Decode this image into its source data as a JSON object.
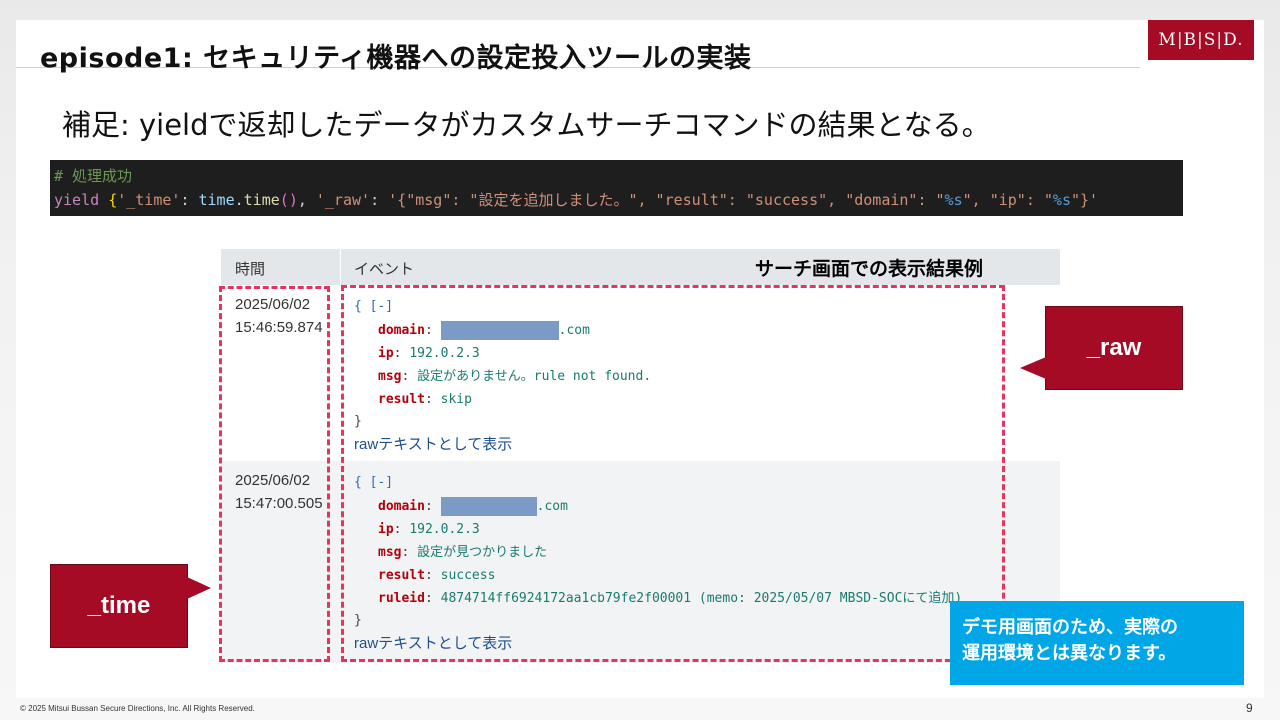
{
  "slide": {
    "title": "episode1: セキュリティ機器への設定投入ツールの実装",
    "subtitle": "補足: yieldで返却したデータがカスタムサーチコマンドの結果となる。",
    "logo": "M|B|S|D.",
    "page_number": "9",
    "copyright": "© 2025 Mitsui Bussan Secure Directions, Inc.  All Rights Reserved."
  },
  "code": {
    "comment": "# 処理成功",
    "yield_kw": "yield",
    "open_brace": "{",
    "time_key": "'_time'",
    "colon1": ": ",
    "time_obj": "time",
    "dot": ".",
    "time_fn": "time",
    "paren_open": "(",
    "paren_close": ")",
    "comma1": ", ",
    "raw_key": "'_raw'",
    "colon2": ": ",
    "raw_str_a": "'{\"msg\": \"設定を追加しました。\", \"result\": \"success\", \"domain\": \"",
    "fmt1": "%s",
    "raw_str_b": "\", \"ip\": \"",
    "fmt2": "%s",
    "raw_str_c": "\"}'"
  },
  "table": {
    "header_time": "時間",
    "header_event": "イベント",
    "header_note": "サーチ画面での表示結果例",
    "rows": [
      {
        "date": "2025/06/02",
        "time": "15:46:59.874",
        "open": "{ [-]",
        "domain_key": "domain",
        "domain_suffix": ".com",
        "ip_key": "ip",
        "ip_val": "192.0.2.3",
        "msg_key": "msg",
        "msg_val": "設定がありません。rule not found.",
        "result_key": "result",
        "result_val": "skip",
        "close": "}",
        "raw_link": "rawテキストとして表示"
      },
      {
        "date": "2025/06/02",
        "time": "15:47:00.505",
        "open": "{ [-]",
        "domain_key": "domain",
        "domain_suffix": ".com",
        "ip_key": "ip",
        "ip_val": "192.0.2.3",
        "msg_key": "msg",
        "msg_val": "設定が見つかりました",
        "result_key": "result",
        "result_val": "success",
        "ruleid_key": "ruleid",
        "ruleid_val": "4874714ff6924172aa1cb79fe2f00001 (memo: 2025/05/07 MBSD-SOCにて追加)",
        "close": "}",
        "raw_link": "rawテキストとして表示"
      }
    ]
  },
  "callouts": {
    "raw": "_raw",
    "time": "_time"
  },
  "demo_note": {
    "line1": "デモ用画面のため、実際の",
    "line2": "運用環境とは異なります。"
  },
  "colors": {
    "brand": "#a50b25",
    "highlight_dash": "#e8345c",
    "note_bg": "#00a6e6"
  }
}
